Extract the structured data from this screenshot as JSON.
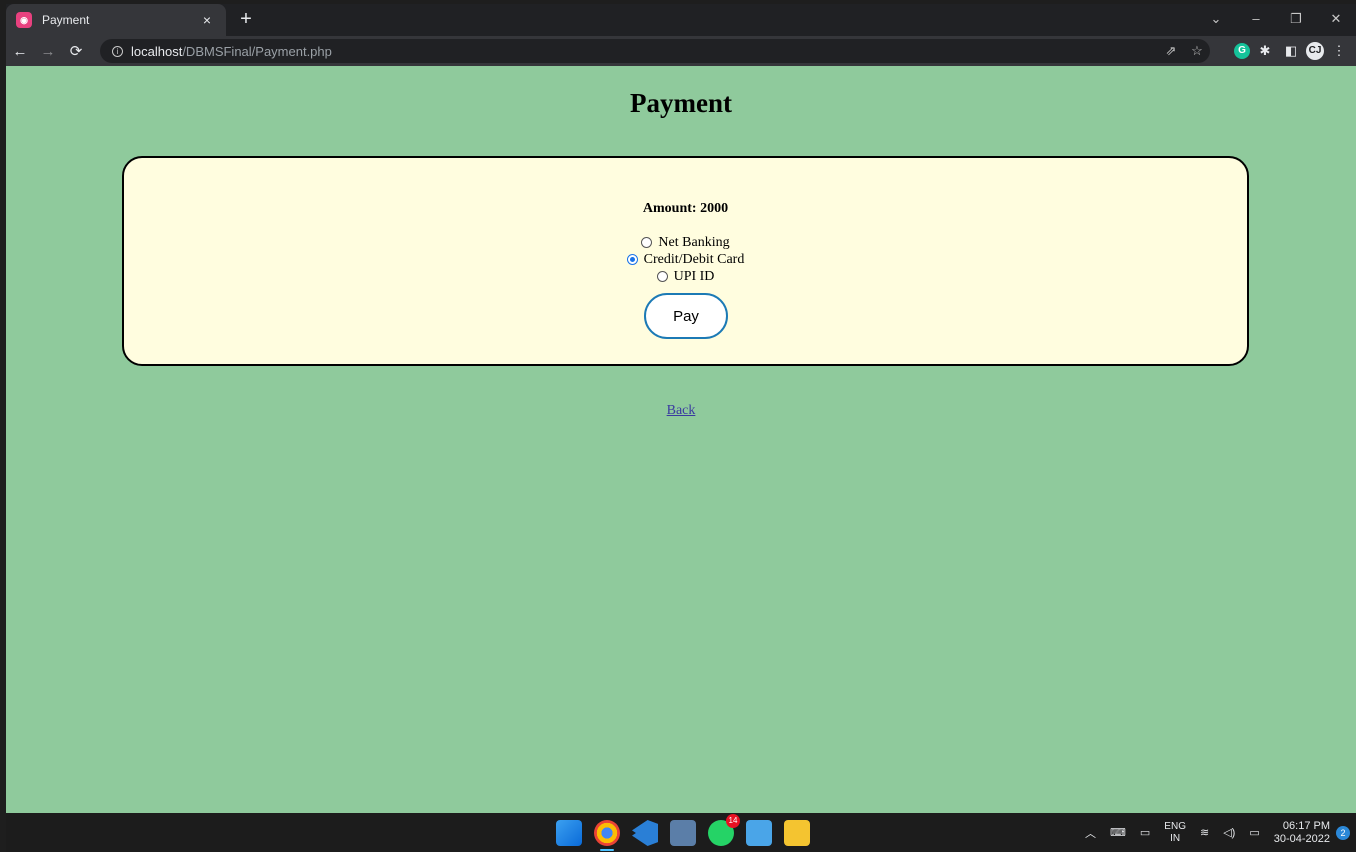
{
  "browser": {
    "tab_title": "Payment",
    "tab_favicon": "php-icon",
    "tab_close": "×",
    "new_tab": "+",
    "url_host": "localhost",
    "url_path": "/DBMSFinal/Payment.php"
  },
  "page": {
    "heading": "Payment",
    "amount_label": "Amount: 2000",
    "options": [
      {
        "label": "Net Banking",
        "checked": false
      },
      {
        "label": "Credit/Debit Card",
        "checked": true
      },
      {
        "label": "UPI ID",
        "checked": false
      }
    ],
    "pay_button": "Pay",
    "back_link": "Back"
  },
  "taskbar": {
    "whatsapp_badge": "14",
    "language": "ENG",
    "region": "IN",
    "time": "06:17 PM",
    "date": "30-04-2022",
    "notification_count": "2"
  },
  "colors": {
    "page_background": "#8fca9c",
    "card_background": "#fffddf",
    "pay_button_border": "#1c7ab5"
  }
}
